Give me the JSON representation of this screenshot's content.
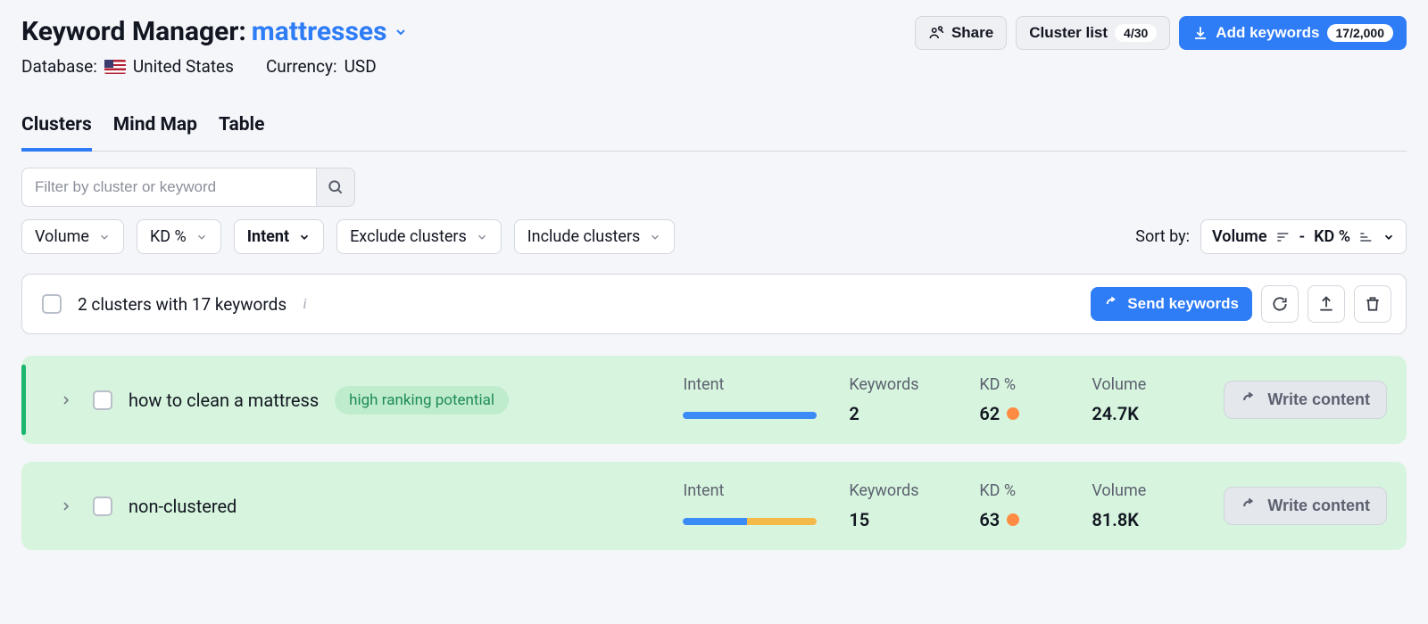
{
  "header": {
    "title_prefix": "Keyword Manager:",
    "keyword": "mattresses",
    "database_label": "Database:",
    "database_value": "United States",
    "currency_label": "Currency:",
    "currency_value": "USD"
  },
  "actions": {
    "share_label": "Share",
    "cluster_list_label": "Cluster list",
    "cluster_list_count": "4/30",
    "add_keywords_label": "Add keywords",
    "add_keywords_count": "17/2,000"
  },
  "tabs": [
    {
      "label": "Clusters",
      "active": true
    },
    {
      "label": "Mind Map",
      "active": false
    },
    {
      "label": "Table",
      "active": false
    }
  ],
  "filters": {
    "search_placeholder": "Filter by cluster or keyword",
    "volume": "Volume",
    "kd": "KD %",
    "intent": "Intent",
    "exclude": "Exclude clusters",
    "include": "Include clusters",
    "sort_label": "Sort by:",
    "sort_primary": "Volume",
    "sort_separator": "-",
    "sort_secondary": "KD %"
  },
  "summary": {
    "text": "2 clusters with 17 keywords",
    "send_label": "Send keywords"
  },
  "metric_labels": {
    "intent": "Intent",
    "keywords": "Keywords",
    "kd": "KD %",
    "volume": "Volume"
  },
  "write_content_label": "Write content",
  "clusters": [
    {
      "name": "how to clean a mattress",
      "badge": "high ranking potential",
      "accented": true,
      "intent_segments": [
        {
          "color": "#3b8cf6",
          "pct": 100
        }
      ],
      "keywords": "2",
      "kd": "62",
      "kd_color": "#ff8c42",
      "volume": "24.7K"
    },
    {
      "name": "non-clustered",
      "badge": null,
      "accented": false,
      "intent_segments": [
        {
          "color": "#3b8cf6",
          "pct": 48
        },
        {
          "color": "#f5b94a",
          "pct": 52
        }
      ],
      "keywords": "15",
      "kd": "63",
      "kd_color": "#ff8c42",
      "volume": "81.8K"
    }
  ]
}
